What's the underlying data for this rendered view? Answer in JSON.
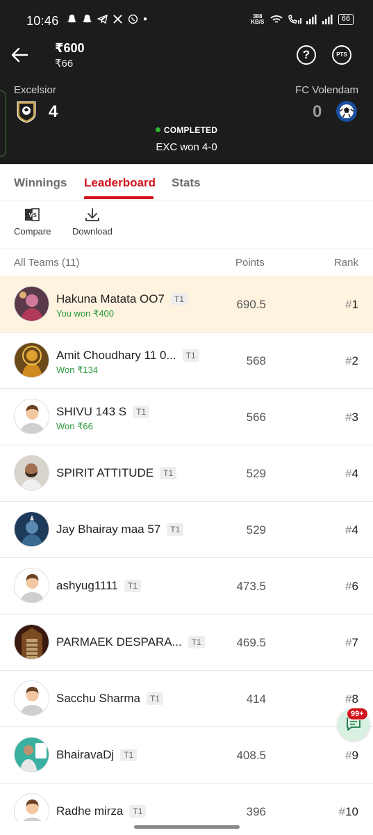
{
  "status_bar": {
    "time": "10:46",
    "net_speed": "388 KB/S",
    "battery": "66"
  },
  "contest": {
    "entry_fee": "₹600",
    "prize": "₹66",
    "help_label": "?",
    "pts_label": "PTS"
  },
  "match": {
    "team1": {
      "name": "Excelsior",
      "score": "4"
    },
    "team2": {
      "name": "FC Volendam",
      "score": "0"
    },
    "status": "COMPLETED",
    "result": "EXC won 4-0",
    "colors": {
      "status_dot": "#2eb82e"
    }
  },
  "tabs": [
    {
      "label": "Winnings",
      "active": false
    },
    {
      "label": "Leaderboard",
      "active": true
    },
    {
      "label": "Stats",
      "active": false
    }
  ],
  "toolbar": {
    "compare_label": "Compare",
    "download_label": "Download"
  },
  "list_header": {
    "teams": "All Teams (11)",
    "points": "Points",
    "rank": "Rank"
  },
  "leaderboard": [
    {
      "name": "Hakuna Matata OO7",
      "team": "T1",
      "prize": "You won ₹400",
      "points": "690.5",
      "rank": "1",
      "avatar": "photo-icon"
    },
    {
      "name": "Amit Choudhary 11 0...",
      "team": "T1",
      "prize": "Won ₹134",
      "points": "568",
      "rank": "2",
      "avatar": "photo-icon"
    },
    {
      "name": "SHIVU 143 S",
      "team": "T1",
      "prize": "Won ₹66",
      "points": "566",
      "rank": "3",
      "avatar": "default-user-icon"
    },
    {
      "name": "SPIRIT ATTITUDE",
      "team": "T1",
      "prize": "",
      "points": "529",
      "rank": "4",
      "avatar": "photo-icon"
    },
    {
      "name": "Jay Bhairay maa 57",
      "team": "T1",
      "prize": "",
      "points": "529",
      "rank": "4",
      "avatar": "photo-icon"
    },
    {
      "name": "ashyug1111",
      "team": "T1",
      "prize": "",
      "points": "473.5",
      "rank": "6",
      "avatar": "default-user-icon"
    },
    {
      "name": "PARMAEK DESPARA...",
      "team": "T1",
      "prize": "",
      "points": "469.5",
      "rank": "7",
      "avatar": "photo-icon"
    },
    {
      "name": "Sacchu Sharma",
      "team": "T1",
      "prize": "",
      "points": "414",
      "rank": "8",
      "avatar": "default-user-icon"
    },
    {
      "name": "BhairavaDj",
      "team": "T1",
      "prize": "",
      "points": "408.5",
      "rank": "9",
      "avatar": "photo-icon"
    },
    {
      "name": "Radhe mirza",
      "team": "T1",
      "prize": "",
      "points": "396",
      "rank": "10",
      "avatar": "default-user-icon"
    }
  ],
  "chat": {
    "badge": "99+"
  },
  "colors": {
    "accent": "#d2141d",
    "winner_green": "#2a9a3a",
    "highlight_row": "#fdf3df",
    "header_bg": "#1c1c1c"
  }
}
